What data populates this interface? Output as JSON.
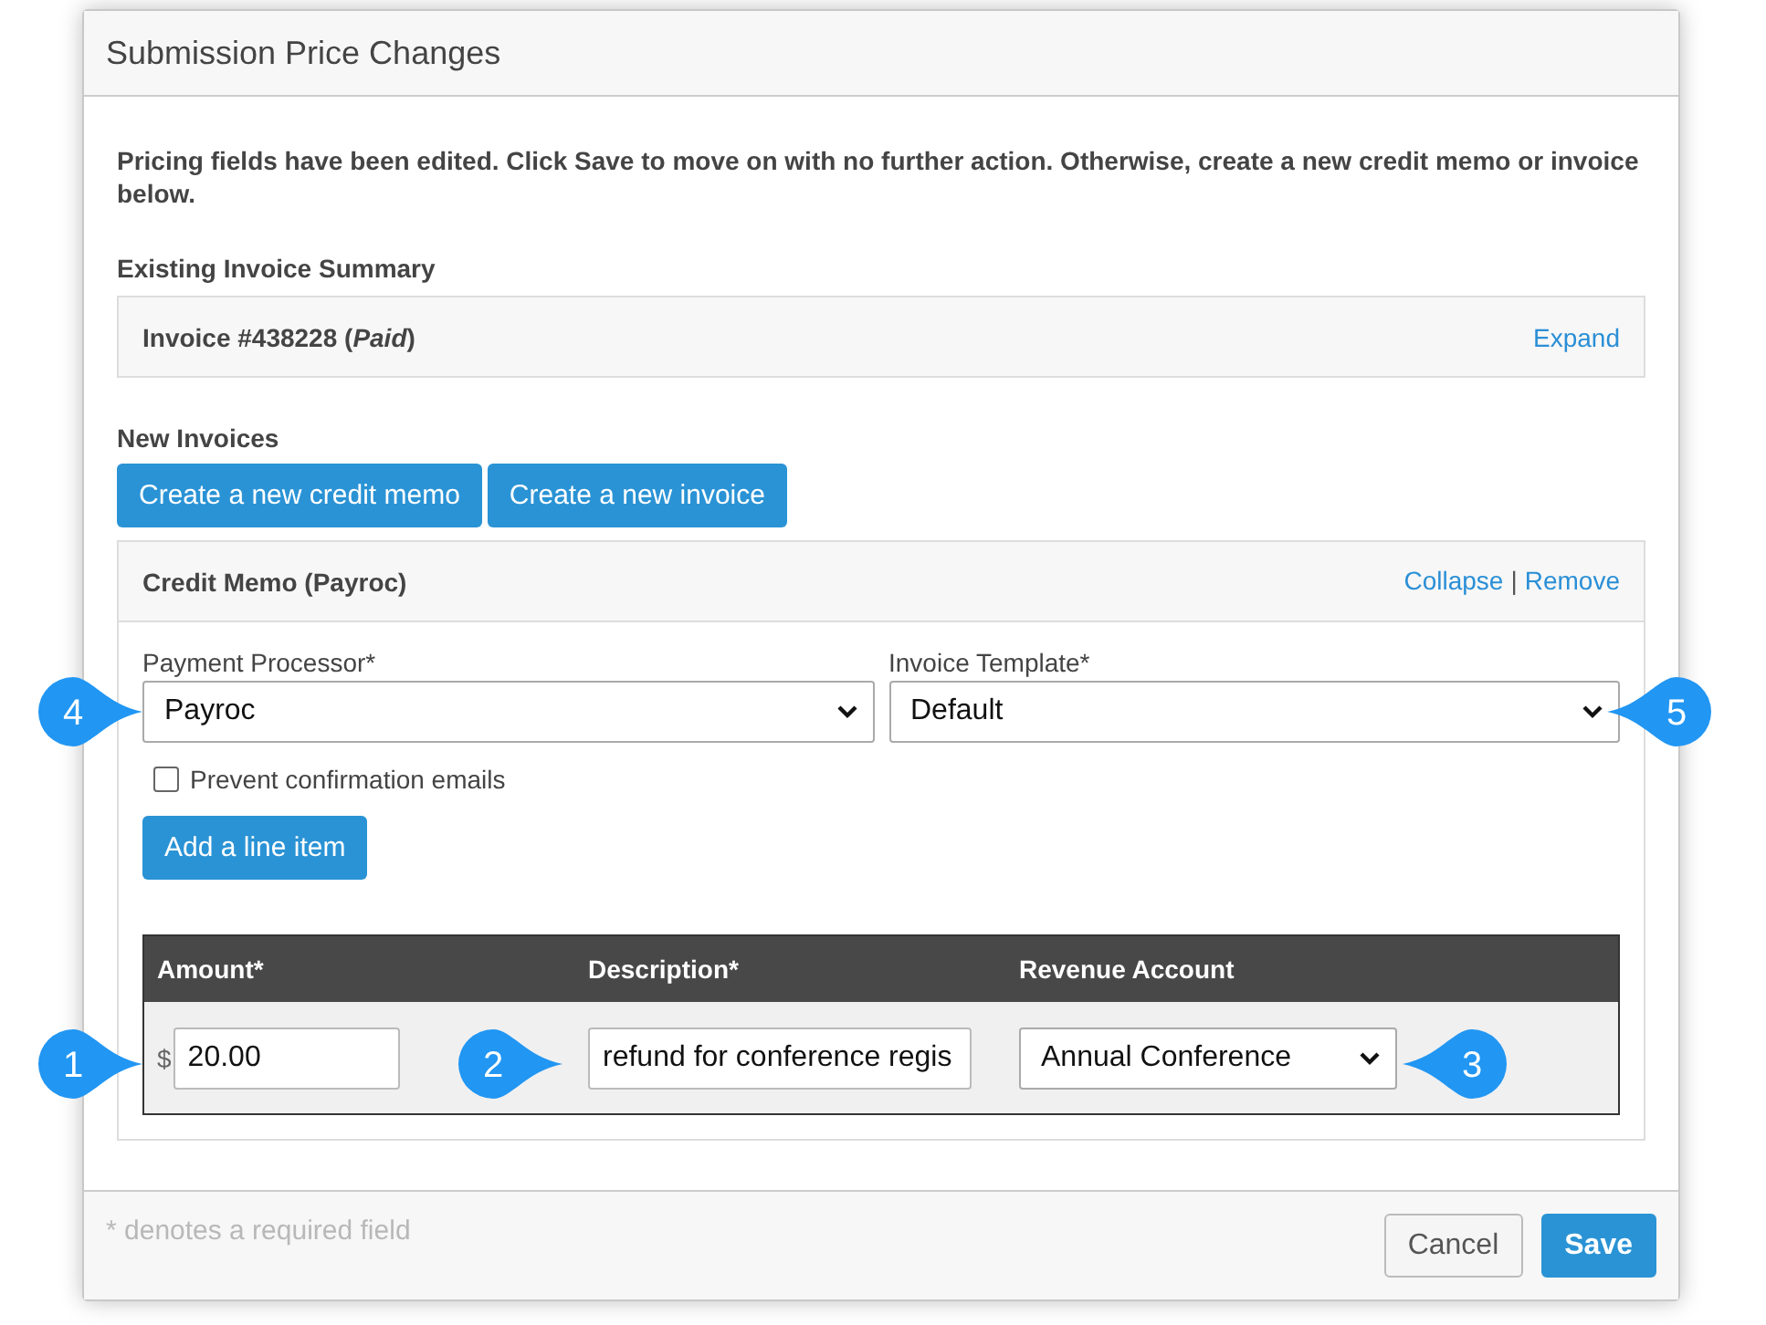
{
  "dialog": {
    "title": "Submission Price Changes",
    "intro": "Pricing fields have been edited. Click Save to move on with no further action. Otherwise, create a new credit memo or invoice below.",
    "existing_label": "Existing Invoice Summary",
    "invoice": {
      "text": "Invoice #438228 (*Paid*)",
      "link": "Expand"
    },
    "new_label": "New Invoices",
    "buttons": [
      "Create a new credit memo",
      "Create a new invoice"
    ],
    "credit_memo": {
      "title": "Credit Memo (Payroc)",
      "links": [
        "Collapse",
        "Remove"
      ],
      "separator": "|",
      "fields": [
        {
          "label": "Payment Processor*",
          "value": "Payroc"
        },
        {
          "label": "Invoice Template*",
          "value": "Default"
        }
      ],
      "checkbox": {
        "label": "Prevent confirmation emails",
        "checked": false
      },
      "add_button": "Add a line item",
      "table": {
        "columns": [
          "Amount*",
          "Description*",
          "Revenue Account"
        ],
        "rows": [
          {
            "currency": "$",
            "amount": "20.00",
            "description": "refund for conference regis",
            "account": "Annual Conference"
          }
        ]
      }
    },
    "footer": {
      "note": "* denotes a required field",
      "buttons": [
        {
          "label": "Cancel",
          "kind": "secondary"
        },
        {
          "label": "Save",
          "kind": "primary"
        }
      ]
    }
  },
  "callouts": [
    {
      "number": "4",
      "kind": "right"
    },
    {
      "number": "5",
      "kind": "left"
    },
    {
      "number": "1",
      "kind": "right"
    },
    {
      "number": "2",
      "kind": "right"
    },
    {
      "number": "3",
      "kind": "left"
    }
  ]
}
